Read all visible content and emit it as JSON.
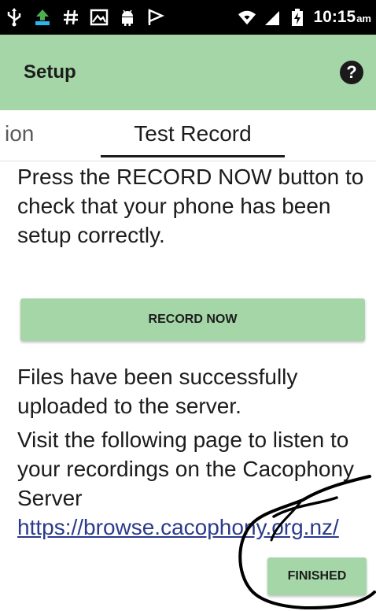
{
  "status_bar": {
    "time": "10:15",
    "time_suffix": "am",
    "left_icons": [
      "usb-icon",
      "upload-icon",
      "hash-icon",
      "gallery-icon",
      "android-icon",
      "flag-icon"
    ],
    "right_icons": [
      "wifi-icon",
      "signal-icon",
      "battery-icon"
    ]
  },
  "app_bar": {
    "title": "Setup",
    "help_icon": "help-icon",
    "help_glyph": "?"
  },
  "tabs": {
    "previous_partial": "ion",
    "active": "Test Record"
  },
  "content": {
    "instructions": "Press the RECORD NOW button to check that your phone has been setup correctly.",
    "record_button": "RECORD NOW",
    "upload_status": "Files have been successfully uploaded to the server.",
    "visit_text": "Visit the following page to listen to your recordings on the Cacophony Server ",
    "link_text": "https://browse.cacophony.org.nz/",
    "finished_button": "FINISHED"
  },
  "colors": {
    "accent_green": "#a5d6a7",
    "link_blue": "#2b3a8c",
    "status_bar": "#000000"
  }
}
